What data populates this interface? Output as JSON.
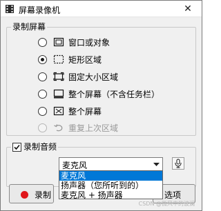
{
  "window": {
    "title": "屏幕录像机",
    "close_glyph": "✕"
  },
  "capture": {
    "group_label": "录制屏幕",
    "options": [
      {
        "label": "窗口或对象",
        "icon": "window-select-icon",
        "checked": false,
        "enabled": true
      },
      {
        "label": "矩形区域",
        "icon": "rectangle-region-icon",
        "checked": true,
        "enabled": true
      },
      {
        "label": "固定大小区域",
        "icon": "fixed-size-region-icon",
        "checked": false,
        "enabled": true
      },
      {
        "label": "整个屏幕（不含任务栏）",
        "icon": "screen-without-taskbar-icon",
        "checked": false,
        "enabled": true
      },
      {
        "label": "整个屏幕",
        "icon": "full-screen-icon",
        "checked": false,
        "enabled": true
      },
      {
        "label": "重复上次区域",
        "icon": "repeat-region-icon",
        "checked": false,
        "enabled": false
      }
    ]
  },
  "audio": {
    "label": "录制音频",
    "checked": true,
    "selected": "麦克风",
    "dropdown_options": [
      "麦克风",
      "扬声器（您所听到的）",
      "麦克风 + 扬声器"
    ],
    "highlighted_index": 0
  },
  "buttons": {
    "record": "录制",
    "options": "选项"
  },
  "colors": {
    "record_dot": "#e0161b",
    "selection": "#0078d7"
  },
  "watermark": "CSDN @微风中的波澜"
}
